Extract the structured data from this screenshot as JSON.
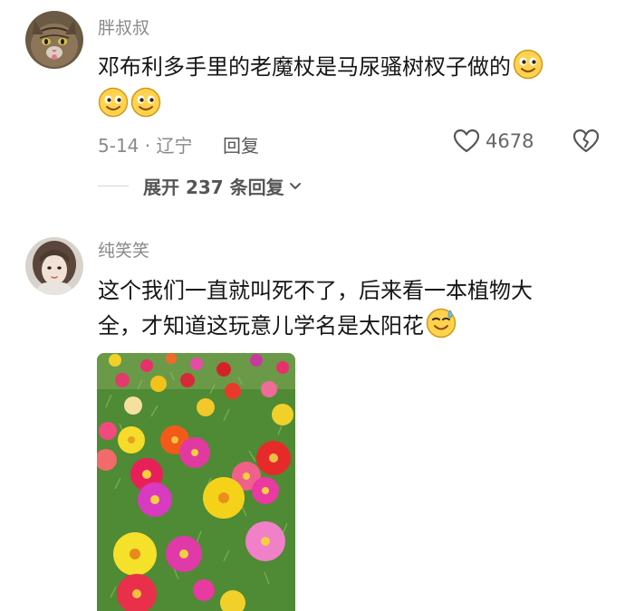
{
  "comments": [
    {
      "username": "胖叔叔",
      "text_line1": "邓布利多手里的老魔杖是马尿骚树杈子做的",
      "date": "5-14",
      "location": "辽宁",
      "reply_label": "回复",
      "likes": "4678",
      "expand_label": "展开 237 条回复",
      "icons": {
        "avatar": "cat-avatar",
        "emoji": "smiling-emoji",
        "like": "heart-icon",
        "dislike": "broken-heart-icon",
        "expand": "chevron-down-icon"
      }
    },
    {
      "username": "纯笑笑",
      "text_line1": "这个我们一直就叫死不了，后来看一本植物大",
      "text_line2": "全，才知道这玩意儿学名是太阳花",
      "icons": {
        "avatar": "girl-avatar",
        "emoji": "sweat-smile-emoji",
        "photo": "sun-flower-photo"
      }
    }
  ],
  "colors": {
    "text_primary": "#161616",
    "text_secondary": "#8a8a8a",
    "emoji_yellow": "#ffd34d"
  }
}
